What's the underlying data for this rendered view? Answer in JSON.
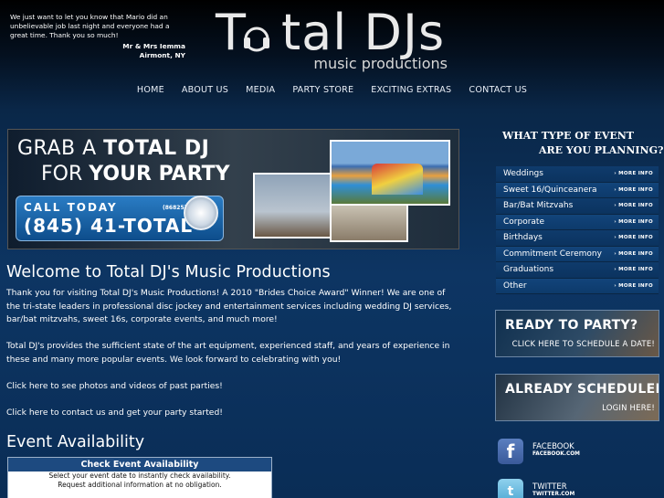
{
  "testimonial": {
    "quote": "We just want to let you know that Mario did an unbelievable job last night and everyone had a great time. Thank you so much!",
    "author": "Mr & Mrs Iemma",
    "location": "Airmont, NY"
  },
  "logo": {
    "brand_left": "T",
    "brand_right": "tal DJs",
    "subtitle": "music productions"
  },
  "nav": {
    "items": [
      "HOME",
      "ABOUT US",
      "MEDIA",
      "PARTY STORE",
      "EXCITING EXTRAS",
      "CONTACT US"
    ]
  },
  "banner": {
    "line1_prefix": "GRAB A ",
    "line1_bold": "TOTAL DJ",
    "line2_prefix": "FOR ",
    "line2_bold": "YOUR PARTY",
    "cta": "CALL TODAY",
    "phone_ext": "(86825)",
    "phone": "(845) 41-TOTAL"
  },
  "main": {
    "heading": "Welcome to Total DJ's Music Productions",
    "paragraphs": [
      "Thank you for visiting Total DJ's Music Productions! A 2010 \"Brides Choice Award\" Winner! We are one of the tri-state leaders in professional disc jockey and entertainment services including wedding DJ services, bar/bat mitzvahs, sweet 16s, corporate events, and much more!",
      "Total DJ's provides the sufficient state of the art equipment, experienced staff, and years of experience in these and many more popular events. We look forward to celebrating with you!",
      "Click here to see photos and videos of past parties!",
      "Click here to contact us and get your party started!"
    ],
    "availability_heading": "Event Availability"
  },
  "availability_widget": {
    "title": "Check Event Availability",
    "line1": "Select your event date to instantly check availability.",
    "line2": "Request additional information at no obligation."
  },
  "sidebar": {
    "title_line1": "WHAT TYPE OF EVENT",
    "title_line2": "ARE YOU PLANNING?",
    "more_label": "› MORE INFO",
    "events": [
      "Weddings",
      "Sweet 16/Quinceanera",
      "Bar/Bat Mitzvahs",
      "Corporate",
      "Birthdays",
      "Commitment Ceremony",
      "Graduations",
      "Other"
    ]
  },
  "promos": {
    "ready_title": "READY TO PARTY?",
    "ready_sub": "CLICK HERE TO SCHEDULE A DATE!",
    "sched_title": "ALREADY SCHEDULED?",
    "sched_sub": "LOGIN HERE!"
  },
  "social": {
    "facebook_name": "FACEBOOK",
    "facebook_url": "FACEBOOK.COM",
    "twitter_name": "TWITTER",
    "twitter_url": "TWITTER.COM"
  },
  "colors": {
    "background": "#0a2d56",
    "nav_text": "#e8eef6",
    "sidebar_row": "#12447a",
    "call_box": "#2a7cc4"
  },
  "icons": [
    "headphones-icon",
    "award-seal-icon",
    "facebook-icon",
    "twitter-icon"
  ]
}
